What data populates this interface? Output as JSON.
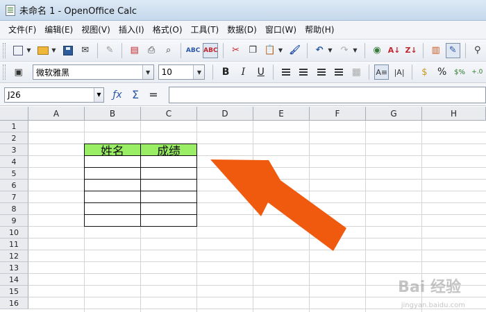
{
  "window": {
    "title": "未命名 1 - OpenOffice Calc"
  },
  "menu": [
    "文件(F)",
    "编辑(E)",
    "视图(V)",
    "插入(I)",
    "格式(O)",
    "工具(T)",
    "数据(D)",
    "窗口(W)",
    "帮助(H)"
  ],
  "format_bar": {
    "font_name": "微软雅黑",
    "font_size": "10",
    "bold_label": "B",
    "italic_label": "I",
    "underline_label": "U",
    "percent_label": "%"
  },
  "formula_bar": {
    "cell_reference": "J26",
    "formula_value": ""
  },
  "sheet": {
    "columns": [
      "A",
      "B",
      "C",
      "D",
      "E",
      "F",
      "G",
      "H"
    ],
    "rows": [
      "1",
      "2",
      "3",
      "4",
      "5",
      "6",
      "7",
      "8",
      "9",
      "10",
      "11",
      "12",
      "13",
      "14",
      "15",
      "16"
    ],
    "table": {
      "headers": [
        "姓名",
        "成绩"
      ],
      "header_fill": "#99ee66",
      "empty_rows": 6
    }
  },
  "annotation": {
    "arrow_color": "#f05a0f"
  },
  "watermark": {
    "text": "Bai 经验",
    "sub": "jingyan.baidu.com"
  }
}
